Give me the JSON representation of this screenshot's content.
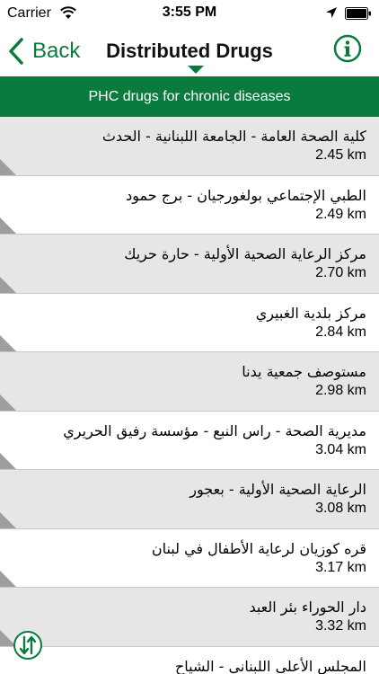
{
  "status_bar": {
    "carrier": "Carrier",
    "time": "3:55 PM"
  },
  "nav": {
    "back_label": "Back",
    "title": "Distributed Drugs"
  },
  "section": {
    "header": "PHC drugs for chronic diseases"
  },
  "colors": {
    "accent": "#0b7a3d",
    "row_shade": "#e6e6e6",
    "corner": "#9e9e9e"
  },
  "icons": {
    "back": "chevron-left-icon",
    "info": "info-circle-icon",
    "sort": "sort-distance-icon",
    "wifi": "wifi-icon",
    "location": "location-arrow-icon",
    "battery": "battery-icon"
  },
  "facilities": [
    {
      "name": "كلية الصحة العامة - الجامعة اللبنانية - الحدث",
      "distance": "2.45 km"
    },
    {
      "name": "الطبي الإجتماعي بولغورجيان - برج حمود",
      "distance": "2.49 km"
    },
    {
      "name": "مركز الرعاية الصحية الأولية - حارة حريك",
      "distance": "2.70 km"
    },
    {
      "name": "مركز بلدية الغبيري",
      "distance": "2.84 km"
    },
    {
      "name": "مستوصف جمعية يدنا",
      "distance": "2.98 km"
    },
    {
      "name": "مديرية الصحة - راس النبع - مؤسسة رفيق الحريري",
      "distance": "3.04 km"
    },
    {
      "name": "الرعاية الصحية الأولية - بعجور",
      "distance": "3.08 km"
    },
    {
      "name": "قره كوزيان لرعاية الأطفال في لبنان",
      "distance": "3.17 km"
    },
    {
      "name": "دار الحوراء بئر العبد",
      "distance": "3.32 km"
    },
    {
      "name": "المجلس الأعلى اللبناني - الشياح",
      "distance": ""
    }
  ]
}
